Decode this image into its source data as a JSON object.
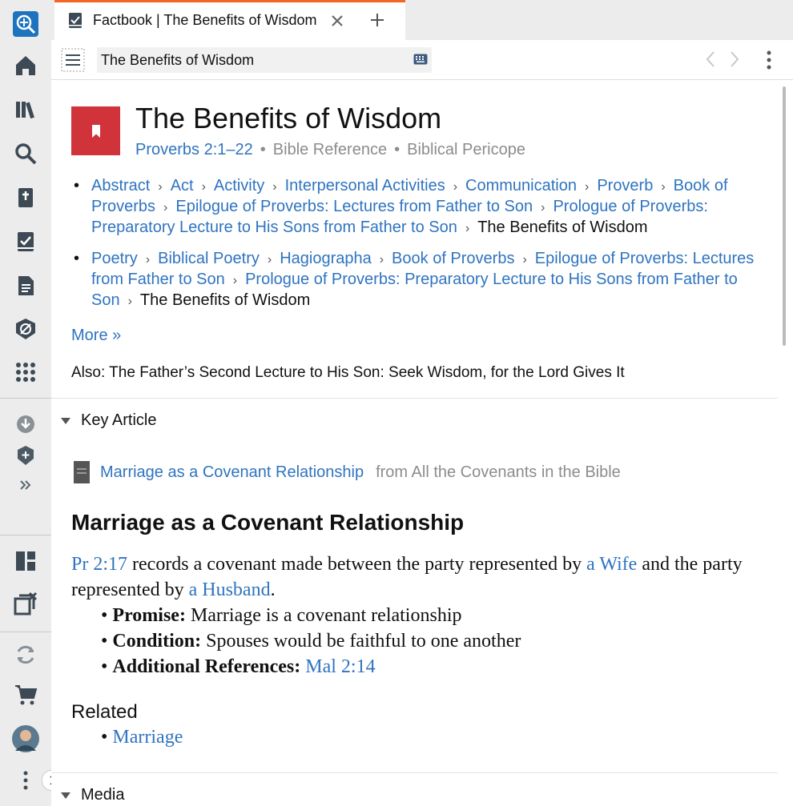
{
  "tab": {
    "title": "Factbook | The Benefits of Wisdom"
  },
  "search": {
    "value": "The Benefits of Wisdom"
  },
  "header": {
    "title": "The Benefits of Wisdom",
    "reference": "Proverbs 2:1–22",
    "type1": "Bible Reference",
    "type2": "Biblical Pericope"
  },
  "breadcrumbs": [
    {
      "links": [
        "Abstract",
        "Act",
        "Activity",
        "Interpersonal Activities",
        "Communication",
        "Proverb",
        "Book of Proverbs",
        "Epilogue of Proverbs: Lectures from Father to Son",
        "Prologue of Proverbs: Preparatory Lecture to His Sons from Father to Son"
      ],
      "current": "The Benefits of Wisdom"
    },
    {
      "links": [
        "Poetry",
        "Biblical Poetry",
        "Hagiographa",
        "Book of Proverbs",
        "Epilogue of Proverbs: Lectures from Father to Son",
        "Prologue of Proverbs: Preparatory Lecture to His Sons from Father to Son"
      ],
      "current": "The Benefits of Wisdom"
    }
  ],
  "more_label": "More »",
  "also": "Also: The Father’s Second Lecture to His Son: Seek Wisdom, for the Lord Gives It",
  "key_article": {
    "section_label": "Key Article",
    "link": "Marriage as a Covenant Relationship",
    "source": "from All the Covenants in the Bible",
    "heading": "Marriage as a Covenant Relationship",
    "para_ref": "Pr 2:17",
    "para_text1": " records a covenant made between the party represented by ",
    "para_link1": "a Wife",
    "para_text2": " and the party represented by ",
    "para_link2": "a Husband",
    "para_end": ".",
    "items": [
      {
        "label": "Promise:",
        "text": " Marriage is a covenant relationship"
      },
      {
        "label": "Condition:",
        "text": " Spouses would be faithful to one another"
      },
      {
        "label": "Additional References:",
        "link": "Mal 2:14"
      }
    ],
    "related_label": "Related",
    "related_link": "Marriage"
  },
  "media": {
    "section_label": "Media"
  },
  "colors": {
    "accent": "#f26522",
    "link": "#2f74c0",
    "badge": "#d0333a"
  }
}
